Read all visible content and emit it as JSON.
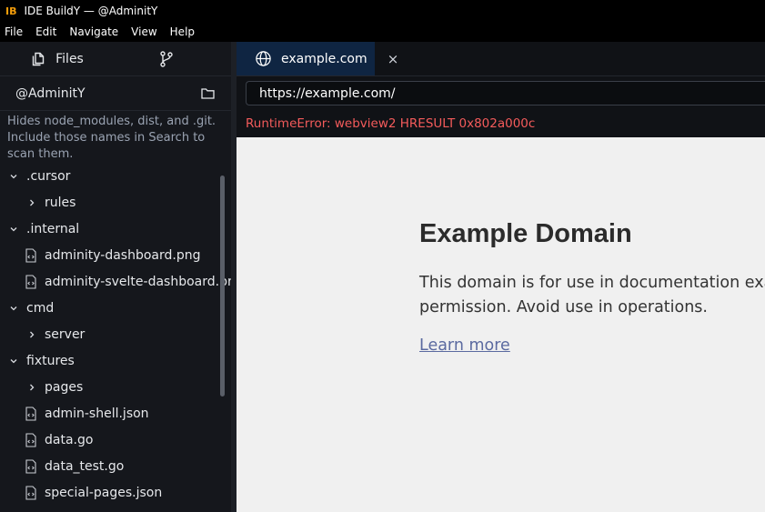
{
  "window": {
    "logo": "IB",
    "title": "IDE BuildY — @AdminitY"
  },
  "menu": [
    "File",
    "Edit",
    "Navigate",
    "View",
    "Help"
  ],
  "sidebar": {
    "files_tab": "Files",
    "workspace": "@AdminitY",
    "hint": "Hides node_modules, dist, and .git. Include those names in Search to scan them.",
    "tree": [
      {
        "label": ".cursor",
        "kind": "folder-open"
      },
      {
        "label": "rules",
        "kind": "folder-closed"
      },
      {
        "label": ".internal",
        "kind": "folder-open"
      },
      {
        "label": "adminity-dashboard.png",
        "kind": "file"
      },
      {
        "label": "adminity-svelte-dashboard.pr",
        "kind": "file"
      },
      {
        "label": "cmd",
        "kind": "folder-open"
      },
      {
        "label": "server",
        "kind": "folder-closed"
      },
      {
        "label": "fixtures",
        "kind": "folder-open"
      },
      {
        "label": "pages",
        "kind": "folder-closed"
      },
      {
        "label": "admin-shell.json",
        "kind": "file"
      },
      {
        "label": "data.go",
        "kind": "file"
      },
      {
        "label": "data_test.go",
        "kind": "file"
      },
      {
        "label": "special-pages.json",
        "kind": "file"
      }
    ]
  },
  "browser": {
    "tab_label": "example.com",
    "close_glyph": "×",
    "url": "https://example.com/",
    "error": "RuntimeError: webview2 HRESULT 0x802a000c"
  },
  "page": {
    "heading": "Example Domain",
    "line1": "This domain is for use in documentation examples without needing",
    "line2": "permission. Avoid use in operations.",
    "link": "Learn more"
  },
  "colors": {
    "accent_tab": "#0f2542",
    "error": "#f45b5b",
    "logo": "#f59e0b"
  }
}
